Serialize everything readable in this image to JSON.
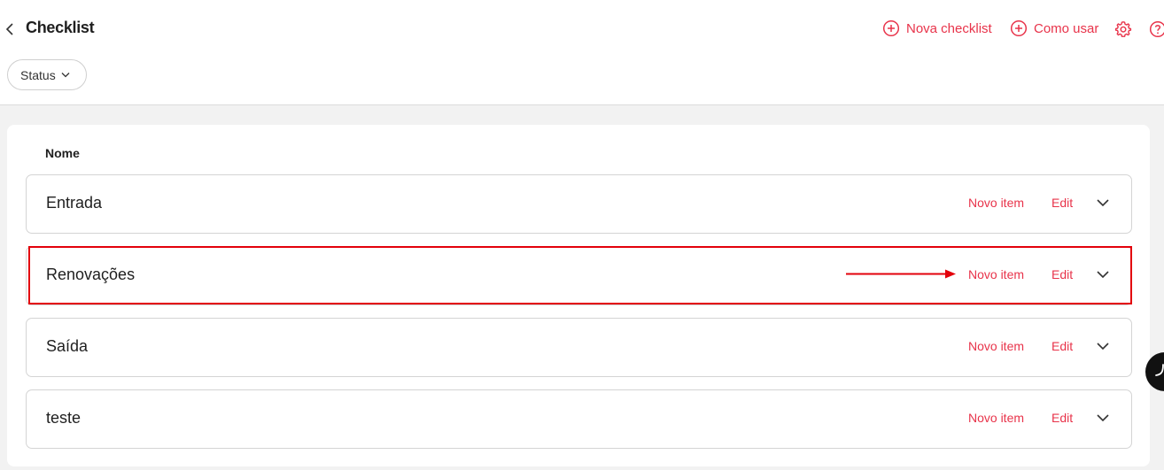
{
  "header": {
    "title": "Checklist",
    "actions": {
      "new_checklist": "Nova checklist",
      "how_to_use": "Como usar"
    }
  },
  "filters": {
    "status_label": "Status"
  },
  "table": {
    "column_header": "Nome",
    "rows": [
      {
        "name": "Entrada",
        "new_item": "Novo item",
        "edit": "Edit"
      },
      {
        "name": "Renovações",
        "new_item": "Novo item",
        "edit": "Edit"
      },
      {
        "name": "Saída",
        "new_item": "Novo item",
        "edit": "Edit"
      },
      {
        "name": "teste",
        "new_item": "Novo item",
        "edit": "Edit"
      }
    ]
  },
  "colors": {
    "accent": "#e8334a",
    "highlight": "#e3000b"
  }
}
